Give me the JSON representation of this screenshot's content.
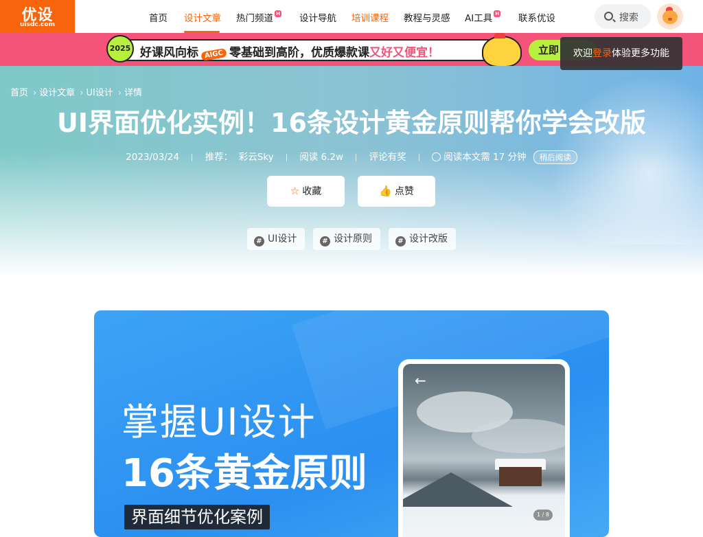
{
  "logo": {
    "zh": "优设",
    "en": "uisdc.com"
  },
  "nav": {
    "items": [
      {
        "label": "首页"
      },
      {
        "label": "设计文章"
      },
      {
        "label": "热门频道"
      },
      {
        "label": "设计导航"
      },
      {
        "label": "培训课程"
      },
      {
        "label": "教程与灵感"
      },
      {
        "label": "AI工具"
      },
      {
        "label": "联系优设"
      }
    ],
    "hot_badge": "H",
    "search_label": "搜索"
  },
  "banner": {
    "year": "2025",
    "text_part1": "好课风向标",
    "text_mid": "AIGC",
    "text_part2": "零基础到高阶，优质爆款课",
    "text_highlight": "又好又便宜！",
    "button": "立即"
  },
  "tooltip": {
    "prefix": "欢迎",
    "login": "登录",
    "suffix": "体验更多功能"
  },
  "breadcrumb": [
    "首页",
    "设计文章",
    "UI设计",
    "详情"
  ],
  "article": {
    "title": "UI界面优化实例！16条设计黄金原则帮你学会改版",
    "date": "2023/03/24",
    "recommend_label": "推荐：",
    "recommender": "彩云Sky",
    "views": "阅读 6.2w",
    "comments": "评论有奖",
    "read_time": "阅读本文需 17 分钟",
    "read_later": "稍后阅读",
    "collect": "收藏",
    "like": "点赞",
    "tags": [
      "UI设计",
      "设计原则",
      "设计改版"
    ]
  },
  "cover": {
    "line1": "掌握UI设计",
    "line2": "16条黄金原则",
    "line3": "界面细节优化案例",
    "pager": "1 / 8",
    "back_icon": "←"
  },
  "colors": {
    "brand": "#f8640b",
    "banner_pink": "#f4547a",
    "banner_green": "#b6ef3e"
  }
}
